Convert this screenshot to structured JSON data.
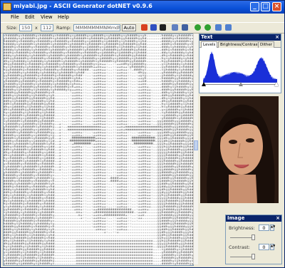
{
  "window": {
    "title": "miyabi.jpg - ASCII Generator dotNET v0.9.6"
  },
  "menu": [
    "File",
    "Edit",
    "View",
    "Help"
  ],
  "toolbar": {
    "size_label": "Size:",
    "width": "150",
    "x_label": "x",
    "height": "112",
    "ramp_label": "Ramp:",
    "ramp_value": "MMMMMMMNMmdhyso+:-.`",
    "auto_label": "Auto",
    "icons": [
      "font-icon",
      "italic-icon",
      "sharpen-icon",
      "view-icon",
      "fullscreen-icon",
      "green-rotate-left-icon",
      "green-rotate-right-icon",
      "triangle-up-icon",
      "triangle-left-icon"
    ]
  },
  "text_panel": {
    "title": "Text",
    "close": "×",
    "tabs": [
      "Levels",
      "Brightness/Contrast",
      "Dither"
    ],
    "active_tab": "Levels",
    "level_min": 0,
    "level_mid": 0.5,
    "level_max": 1
  },
  "image_panel": {
    "title": "Image",
    "close": "×",
    "brightness_label": "Brightness:",
    "brightness_value": "0",
    "contrast_label": "Contrast:",
    "contrast_value": "0"
  },
  "colors": {
    "titlebar": "#0a50d8",
    "histogram": "#1a2fd8"
  }
}
